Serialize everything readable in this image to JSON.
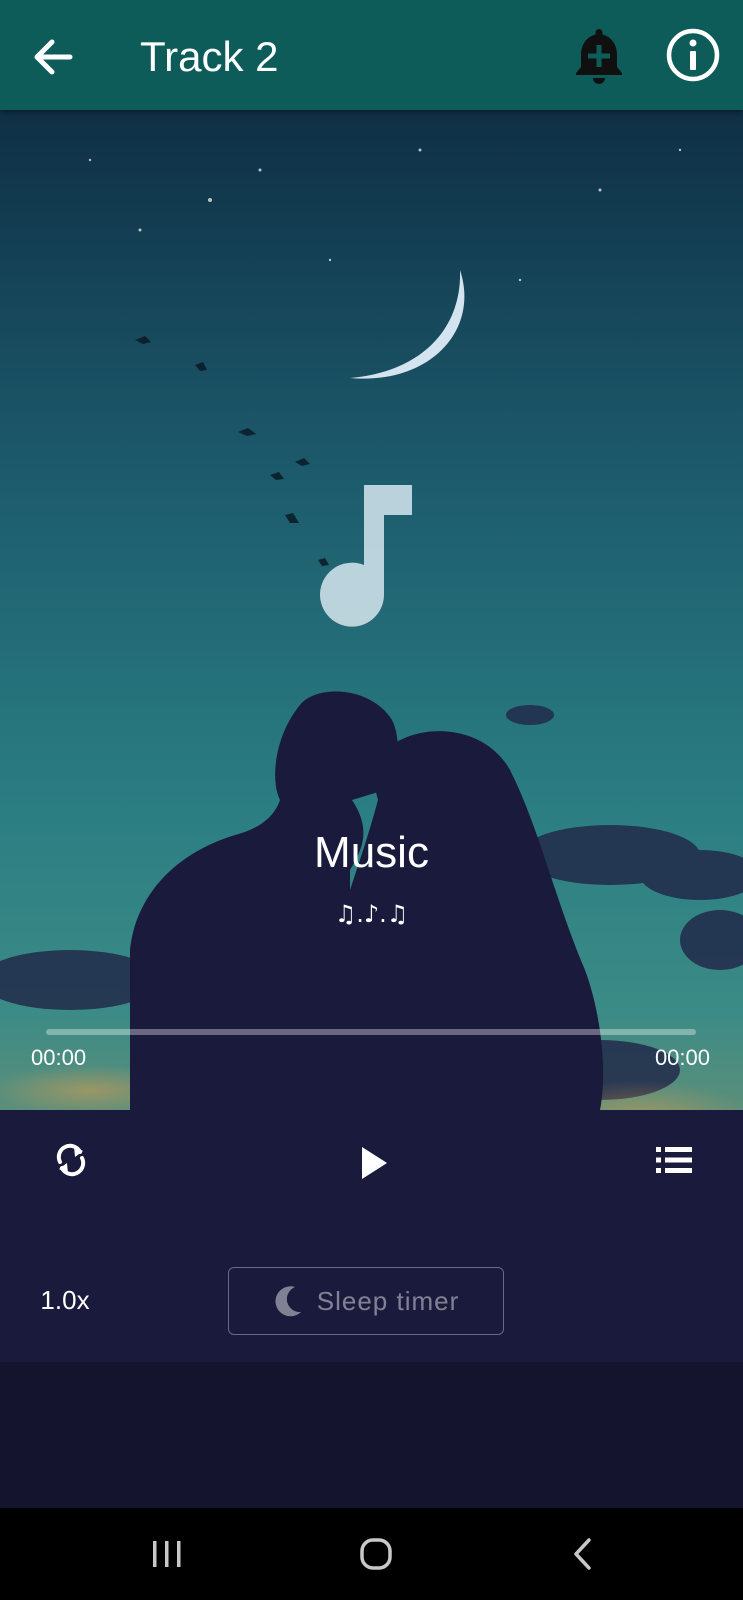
{
  "header": {
    "title": "Track 2",
    "back_icon": "arrow-left-icon",
    "add_alarm_icon": "bell-plus-icon",
    "info_icon": "info-circle-icon",
    "color": "#0d5c5a"
  },
  "player": {
    "artwork_icon": "music-note-icon",
    "song_title": "Music",
    "song_subtitle": "♫.♪.♫",
    "elapsed": "00:00",
    "duration": "00:00",
    "progress": 0,
    "repeat_icon": "repeat-icon",
    "play_icon": "play-icon",
    "playlist_icon": "list-icon",
    "speed": "1.0x",
    "sleep_timer_label": "Sleep timer",
    "sleep_timer_icon": "moon-icon"
  },
  "system_nav": {
    "recents_icon": "recents-icon",
    "home_icon": "home-icon",
    "back_icon": "back-chevron-icon"
  }
}
